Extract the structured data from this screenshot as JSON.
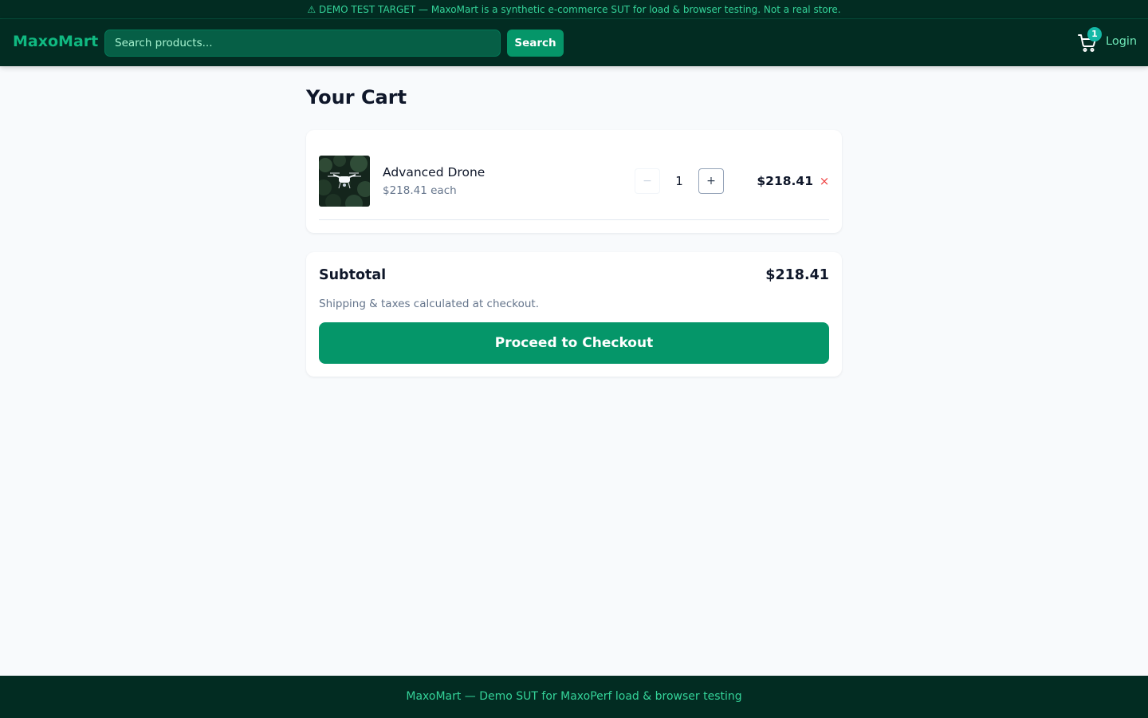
{
  "banner": {
    "text": "⚠ DEMO TEST TARGET — MaxoMart is a synthetic e-commerce SUT for load & browser testing. Not a real store."
  },
  "header": {
    "logo": "MaxoMart",
    "search_placeholder": "Search products...",
    "search_value": "",
    "search_button": "Search",
    "cart_icon": "cart-icon",
    "cart_count": "1",
    "login_label": "Login"
  },
  "cart": {
    "title": "Your Cart",
    "items": [
      {
        "name": "Advanced Drone",
        "unit_price": "$218.41 each",
        "quantity": "1",
        "line_total": "$218.41",
        "decrement_symbol": "−",
        "increment_symbol": "+",
        "remove_symbol": "×"
      }
    ]
  },
  "summary": {
    "subtotal_label": "Subtotal",
    "subtotal_value": "$218.41",
    "shipping_note": "Shipping & taxes calculated at checkout.",
    "checkout_button": "Proceed to Checkout"
  },
  "footer": {
    "text": "MaxoMart — Demo SUT for MaxoPerf load & browser testing"
  },
  "colors": {
    "header_bg": "#022c22",
    "accent": "#059669",
    "remove": "#ef4444",
    "badge": "#14b8a6"
  }
}
